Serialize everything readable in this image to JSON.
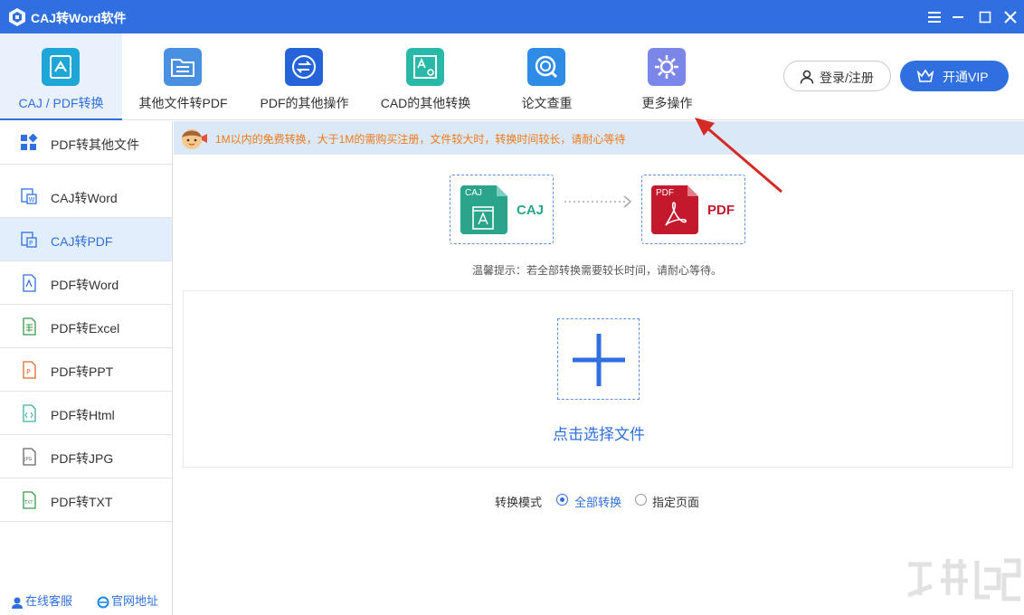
{
  "window": {
    "title": "CAJ转Word软件"
  },
  "toolbar": {
    "tools": [
      {
        "label": "CAJ / PDF转换",
        "icon": "caj-pdf-convert-icon",
        "active": true
      },
      {
        "label": "其他文件转PDF",
        "icon": "folder-icon",
        "active": false
      },
      {
        "label": "PDF的其他操作",
        "icon": "swap-icon",
        "active": false
      },
      {
        "label": "CAD的其他转换",
        "icon": "cad-icon",
        "active": false
      },
      {
        "label": "论文查重",
        "icon": "search-icon",
        "active": false
      },
      {
        "label": "更多操作",
        "icon": "gear-icon",
        "active": false
      }
    ],
    "login_label": "登录/注册",
    "vip_label": "开通VIP"
  },
  "sidebar": {
    "items": [
      {
        "label": "PDF转其他文件",
        "icon": "grid-icon",
        "active": false
      },
      {
        "label": "CAJ转Word",
        "icon": "word-file-icon",
        "active": false
      },
      {
        "label": "CAJ转PDF",
        "icon": "pdf-file-icon",
        "active": true
      },
      {
        "label": "PDF转Word",
        "icon": "pdf-icon",
        "active": false
      },
      {
        "label": "PDF转Excel",
        "icon": "excel-icon",
        "active": false
      },
      {
        "label": "PDF转PPT",
        "icon": "ppt-icon",
        "active": false
      },
      {
        "label": "PDF转Html",
        "icon": "html-icon",
        "active": false
      },
      {
        "label": "PDF转JPG",
        "icon": "jpg-icon",
        "active": false
      },
      {
        "label": "PDF转TXT",
        "icon": "txt-icon",
        "active": false
      }
    ],
    "footer": {
      "support": "在线客服",
      "website": "官网地址"
    }
  },
  "notice": {
    "text": "1M以内的免费转换，大于1M的需购买注册，文件较大时，转换时间较长，请耐心等待"
  },
  "conversion": {
    "from_label": "CAJ",
    "from_badge": "CAJ",
    "to_label": "PDF",
    "to_badge": "PDF",
    "tip": "温馨提示：若全部转换需要较长时间，请耐心等待。"
  },
  "drop": {
    "label": "点击选择文件"
  },
  "mode": {
    "label": "转换模式",
    "options": [
      {
        "label": "全部转换",
        "checked": true
      },
      {
        "label": "指定页面",
        "checked": false
      }
    ]
  },
  "colors": {
    "brand": "#2f6fe0",
    "notice_text": "#ef7a1a",
    "caj_green": "#2aa58c",
    "pdf_red": "#c4182c"
  }
}
